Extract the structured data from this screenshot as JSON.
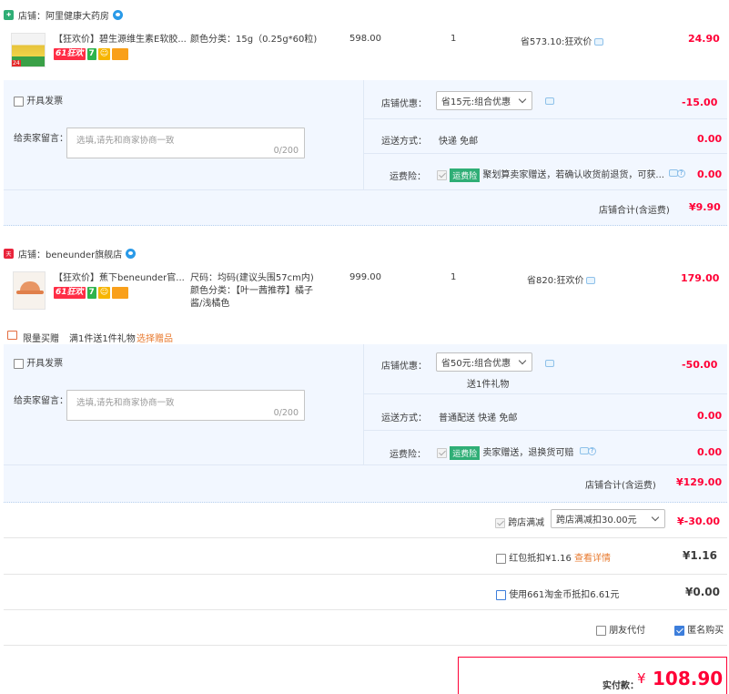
{
  "store1": {
    "name": "店铺：阿里健康大药房",
    "item": {
      "title": "【狂欢价】碧生源维生素E软胶...",
      "tag_61": "61狂欢",
      "tag_7": "7",
      "sku": "颜色分类：15g（0.25g*60粒)",
      "price": "598.00",
      "qty": "1",
      "discount": "省573.10:狂欢价",
      "subtotal": "24.90",
      "thumb_badge": "24"
    },
    "invoice_label": "开具发票",
    "message_label": "给卖家留言：",
    "message_placeholder": "选填,请先和商家协商一致",
    "message_count": "0/200",
    "promo_label": "店铺优惠：",
    "promo_value": "省15元:组合优惠",
    "promo_amount": "-15.00",
    "shipping_label": "运送方式：",
    "shipping_value": "快递 免邮",
    "shipping_amount": "0.00",
    "insurance_label": "运费险：",
    "insurance_badge": "运费险",
    "insurance_text": "聚划算卖家赠送，若确认收货前退货，可获...",
    "insurance_amount": "0.00",
    "total_label": "店铺合计(含运费)",
    "total_value": "¥9.90"
  },
  "store2": {
    "name": "店铺：beneunder旗舰店",
    "item": {
      "title": "【狂欢价】蕉下beneunder官...",
      "tag_61": "61狂欢",
      "tag_7": "7",
      "sku_line1": "尺码：均码(建议头围57cm内)",
      "sku_line2": "颜色分类：【叶一茜推荐】橘子",
      "sku_line3": "酱/浅橘色",
      "price": "999.00",
      "qty": "1",
      "discount": "省820:狂欢价",
      "subtotal": "179.00"
    },
    "gift_label": "限量买赠",
    "gift_text": "满1件送1件礼物",
    "gift_link": "选择赠品",
    "invoice_label": "开具发票",
    "message_label": "给卖家留言：",
    "message_placeholder": "选填,请先和商家协商一致",
    "message_count": "0/200",
    "promo_label": "店铺优惠：",
    "promo_value": "省50元:组合优惠",
    "promo_sub": "送1件礼物",
    "promo_amount": "-50.00",
    "shipping_label": "运送方式：",
    "shipping_value": "普通配送 快递 免邮",
    "shipping_amount": "0.00",
    "insurance_label": "运费险：",
    "insurance_badge": "运费险",
    "insurance_text": "卖家赠送，退换货可赔",
    "insurance_amount": "0.00",
    "total_label": "店铺合计(含运费)",
    "total_value": "¥129.00"
  },
  "summary": {
    "cross_store_label": "跨店满减",
    "cross_store_select": "跨店满减扣30.00元",
    "cross_store_amount": "¥-30.00",
    "redpacket_label": "红包抵扣¥1.16",
    "redpacket_link": "查看详情",
    "redpacket_amount": "¥1.16",
    "coins_label": "使用661淘金币抵扣6.61元",
    "coins_amount": "¥0.00",
    "friend_pay_label": "朋友代付",
    "anonymous_label": "匿名购买",
    "actual_label": "实付款：",
    "actual_currency": "¥",
    "actual_value": "108.90"
  },
  "colors": {
    "accent_red": "#ff0036",
    "panel_bg": "#f2f7ff",
    "green": "#2fae76",
    "blue": "#3d7edb"
  }
}
